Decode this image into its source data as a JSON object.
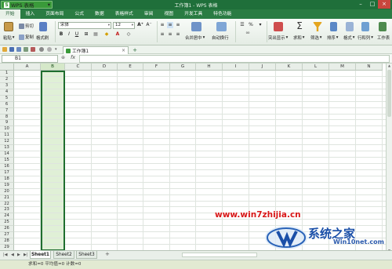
{
  "app": {
    "name": "WPS 表格",
    "window_title": "工作簿1 - WPS 表格"
  },
  "menu": [
    "开始",
    "插入",
    "页面布局",
    "公式",
    "数据",
    "表格样式",
    "审阅",
    "视图",
    "开发工具",
    "特色功能"
  ],
  "ribbon": {
    "paste": "粘贴",
    "cut": "剪切",
    "copy": "复制",
    "format_painter": "格式刷",
    "font_name": "宋体",
    "font_size": "12",
    "bold": "B",
    "italic": "I",
    "underline": "U",
    "grow_font": "A⁺",
    "shrink_font": "A⁻",
    "merge_center": "合并居中",
    "wrap_text": "自动换行",
    "number_format": "%",
    "comma_format": "⁰⁰",
    "highlight": "突出显示",
    "sum": "求和",
    "filter": "筛选",
    "sort": "排序",
    "format": "格式",
    "row_col": "行和列",
    "worksheet": "工作表"
  },
  "doc_tab": "工作簿1",
  "name_box": "B1",
  "formula_fx": "fx",
  "columns": [
    "A",
    "B",
    "C",
    "D",
    "E",
    "F",
    "G",
    "H",
    "I",
    "J",
    "K",
    "L",
    "M",
    "N"
  ],
  "rows": [
    "1",
    "2",
    "3",
    "4",
    "5",
    "6",
    "7",
    "8",
    "9",
    "10",
    "11",
    "12",
    "13",
    "14",
    "15",
    "16",
    "17",
    "18",
    "19",
    "20",
    "21",
    "22",
    "23",
    "24",
    "25",
    "26",
    "27",
    "28",
    "29"
  ],
  "selected_column": "B",
  "sheets": [
    "Sheet1",
    "Sheet2",
    "Sheet3"
  ],
  "active_sheet": "Sheet1",
  "status": "求和=0  平均值=0  计数=0",
  "watermark": {
    "url_text": "www.win7zhijia.cn",
    "brand": "系统之家",
    "site": "Win10net.com"
  },
  "colors": {
    "title_green": "#1f6f3a",
    "menu_green": "#2a7c43",
    "selection": "#1f6e2f",
    "selected_fill": "#e0f0d6"
  }
}
